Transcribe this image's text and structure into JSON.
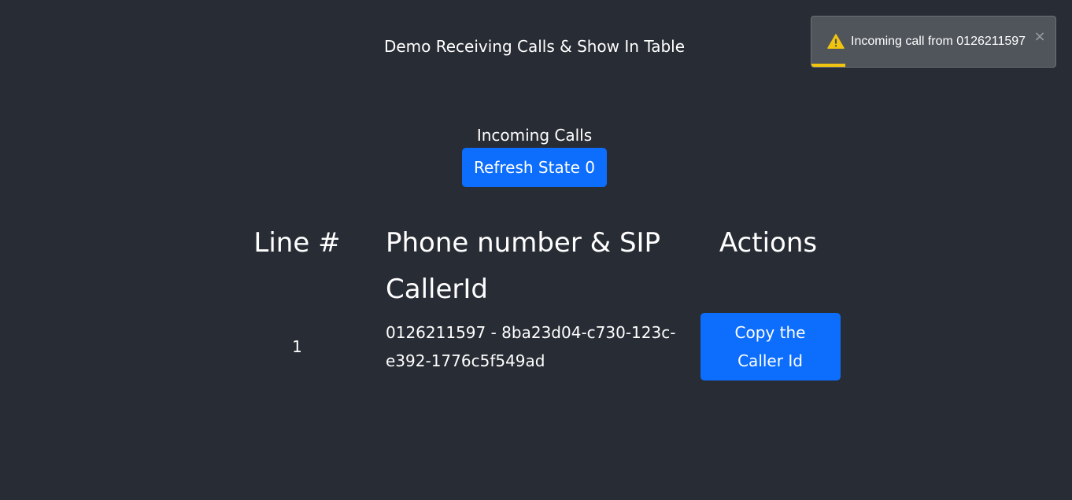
{
  "header": {
    "title": "Demo Receiving Calls & Show In Table"
  },
  "calls": {
    "section_label": "Incoming Calls",
    "refresh_label": "Refresh State 0",
    "columns": [
      "Line #",
      "Phone number & SIP CallerId",
      "Actions"
    ],
    "rows": [
      {
        "line": "1",
        "phone_sip": "0126211597 - 8ba23d04-c730-123c-e392-1776c5f549ad",
        "action_label": "Copy the Caller Id"
      }
    ]
  },
  "toast": {
    "message": "Incoming call from 0126211597",
    "close_glyph": "×",
    "icon": "warning-icon",
    "progress_fraction": 0.14,
    "colors": {
      "background": "#50555c",
      "progress": "#f1c40f",
      "warning": "#f1c40f"
    }
  },
  "colors": {
    "background": "#282c34",
    "primary_button": "#0d6efd",
    "text": "#ffffff"
  }
}
